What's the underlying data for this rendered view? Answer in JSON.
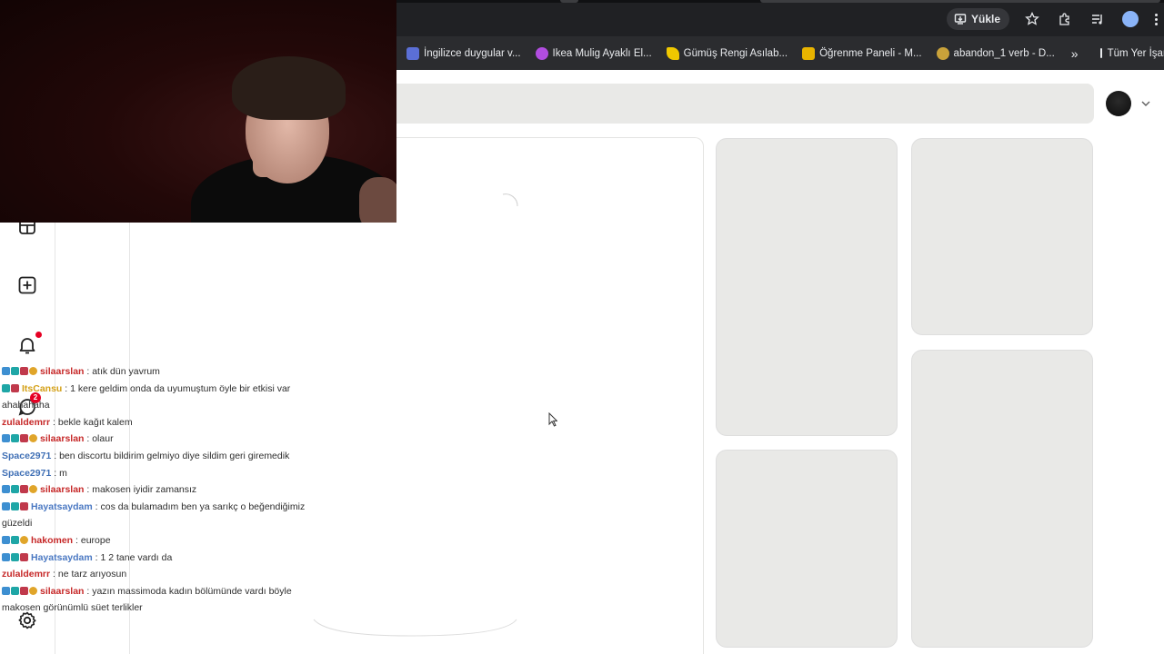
{
  "browser": {
    "upload_label": "Yükle",
    "bookmarks": [
      {
        "label": "İngilizce duygular v...",
        "color": "#5b6fd6"
      },
      {
        "label": "Ikea Mulig Ayaklı El...",
        "color": "#b14de0"
      },
      {
        "label": "Gümüş Rengi Asılab...",
        "color": "#f0c800"
      },
      {
        "label": "Öğrenme Paneli - M...",
        "color": "#e8b400"
      },
      {
        "label": "abandon_1 verb - D...",
        "color": "#c9a23a"
      }
    ],
    "bookmarks_more": "»",
    "bookmarks_folder": "Tüm Yer İşaretleri"
  },
  "sidebar": {
    "icons": [
      "dashboard-icon",
      "create-icon",
      "bell-icon",
      "messages-icon",
      "settings-icon"
    ],
    "messages_badge": "2"
  },
  "chat": {
    "messages": [
      {
        "user": "silaarslan",
        "user_color": "#c62828",
        "badges": [
          "b-blue",
          "b-teal",
          "b-red",
          "b-gold"
        ],
        "text": "atık dün yavrum"
      },
      {
        "user": "ItsCansu",
        "user_color": "#d4a017",
        "badges": [
          "b-teal",
          "b-red"
        ],
        "text": "1 kere geldim onda da uyumuştum öyle bir etkisi var ahahahaha"
      },
      {
        "user": "zulaldemrr",
        "user_color": "#c62828",
        "badges": [],
        "text": "bekle kağıt kalem"
      },
      {
        "user": "silaarslan",
        "user_color": "#c62828",
        "badges": [
          "b-blue",
          "b-teal",
          "b-red",
          "b-gold"
        ],
        "text": "olaur"
      },
      {
        "user": "Space2971",
        "user_color": "#3f6fb5",
        "badges": [],
        "text": "ben discortu bildirim gelmiyo diye sildim geri giremedik"
      },
      {
        "user": "Space2971",
        "user_color": "#3f6fb5",
        "badges": [],
        "text": "m"
      },
      {
        "user": "silaarslan",
        "user_color": "#c62828",
        "badges": [
          "b-blue",
          "b-teal",
          "b-red",
          "b-gold"
        ],
        "text": "makosen iyidir zamansız"
      },
      {
        "user": "Hayatsaydam",
        "user_color": "#4a78c2",
        "badges": [
          "b-blue",
          "b-teal",
          "b-red"
        ],
        "text": "cos da bulamadım ben ya sarıkç o beğendiğimiz güzeldi"
      },
      {
        "user": "hakomen",
        "user_color": "#c62828",
        "badges": [
          "b-blue",
          "b-teal",
          "b-gold"
        ],
        "text": "europe"
      },
      {
        "user": "Hayatsaydam",
        "user_color": "#4a78c2",
        "badges": [
          "b-blue",
          "b-teal",
          "b-red"
        ],
        "text": "1 2 tane vardı da"
      },
      {
        "user": "zulaldemrr",
        "user_color": "#c62828",
        "badges": [],
        "text": "ne tarz arıyosun"
      },
      {
        "user": "silaarslan",
        "user_color": "#c62828",
        "badges": [
          "b-blue",
          "b-teal",
          "b-red",
          "b-gold"
        ],
        "text": "yazın massimoda kadın bölümünde vardı böyle makosen görünümlü süet terlikler"
      }
    ]
  }
}
